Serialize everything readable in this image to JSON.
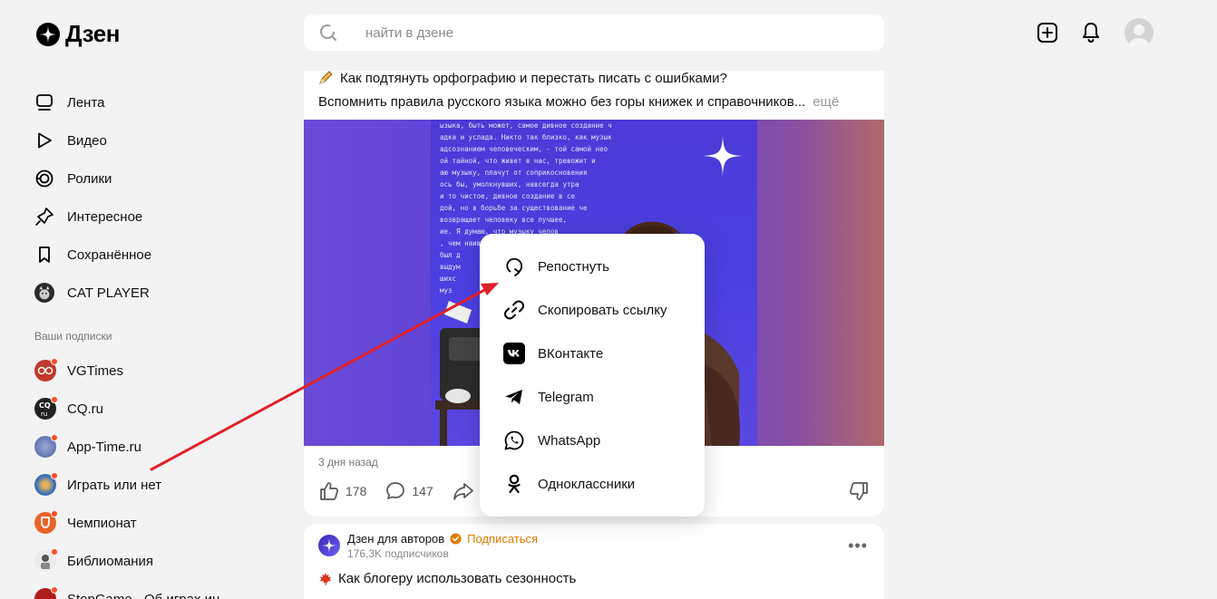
{
  "header": {
    "logo_text": "Дзен",
    "search_placeholder": "найти в дзене",
    "icons": [
      "add-post-icon",
      "bell-icon",
      "avatar"
    ]
  },
  "sidebar": {
    "nav": [
      {
        "label": "Лента",
        "icon": "feed-icon"
      },
      {
        "label": "Видео",
        "icon": "play-icon"
      },
      {
        "label": "Ролики",
        "icon": "shorts-icon"
      },
      {
        "label": "Интересное",
        "icon": "interesting-icon"
      },
      {
        "label": "Сохранённое",
        "icon": "bookmark-icon"
      },
      {
        "label": "CAT PLAYER",
        "icon": "cat-avatar"
      }
    ],
    "subs_title": "Ваши подписки",
    "subs": [
      {
        "label": "VGTimes",
        "color": "#c0392b"
      },
      {
        "label": "CQ.ru",
        "color": "#222222"
      },
      {
        "label": "App-Time.ru",
        "color": "#5a6fb0"
      },
      {
        "label": "Играть или нет",
        "color": "#4a7fc0"
      },
      {
        "label": "Чемпионат",
        "color": "#e8632a"
      },
      {
        "label": "Библиомания",
        "color": "#e8e8e8"
      },
      {
        "label": "StopGame - Об играх ин",
        "color": "#b01c1c"
      }
    ]
  },
  "post": {
    "title": "Как подтянуть орфографию и перестать писать с ошибками?",
    "description": "Вспомнить правила русского языка можно без горы книжек и справочников...",
    "more": "ещё",
    "poster_text": "ызыка, быть может, самое дивное создание че\nадка и услада. Никто так близко, как музыка\nадсознанием человеческим, - той самой нео\nой тайной, что живет в нас, тревожит и\nаю музыку, плачут от соприкосновения\nось бы, умолкнувших, навсегда утра\nи то чистое, дивное создание в се\nдой, но в борьбе за существование че\nвозвращает человеку все лучшее,\nие. Я думаю, что музыку челов\n, чем наивысшей радостью. Возмо\nбыл д\nвыдум\nшихс\nмуз",
    "date": "3 дня назад",
    "likes": "178",
    "comments": "147"
  },
  "share_menu": {
    "items": [
      {
        "label": "Репостнуть",
        "icon": "repost-icon"
      },
      {
        "label": "Скопировать ссылку",
        "icon": "link-icon"
      },
      {
        "label": "ВКонтакте",
        "icon": "vk-icon"
      },
      {
        "label": "Telegram",
        "icon": "telegram-icon"
      },
      {
        "label": "WhatsApp",
        "icon": "whatsapp-icon"
      },
      {
        "label": "Одноклассники",
        "icon": "ok-icon"
      }
    ]
  },
  "post2": {
    "channel": "Дзен для авторов",
    "subscribe": "Подписаться",
    "subscribers": "176,3K подписчиков",
    "title": "Как блогеру использовать сезонность",
    "menu": "•••"
  },
  "colors": {
    "arrow": "#e0202a",
    "accent": "#e07a00",
    "image_purple": "#5a3fd6"
  }
}
